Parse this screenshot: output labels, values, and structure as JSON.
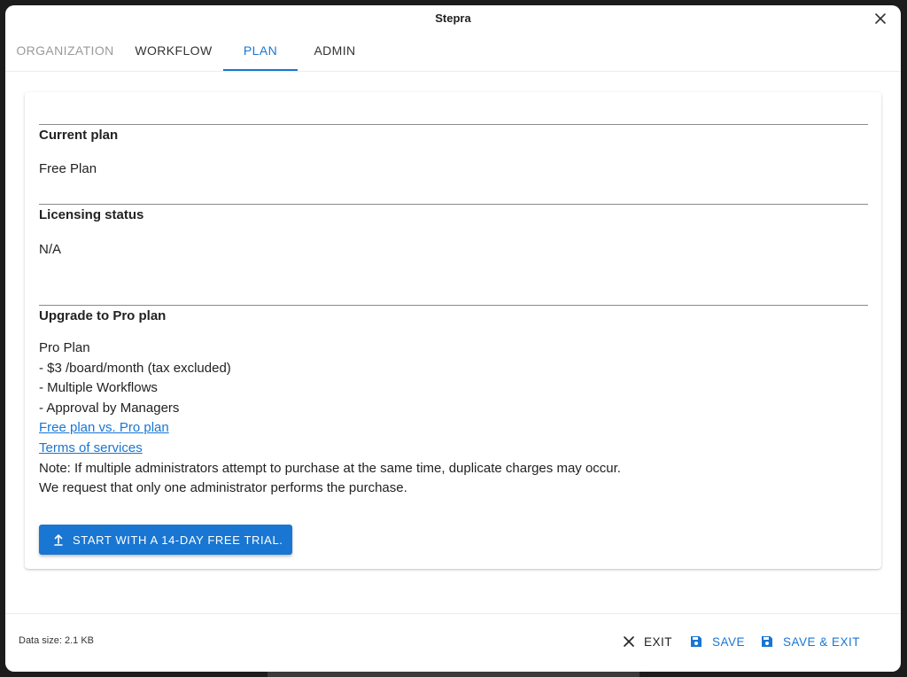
{
  "window": {
    "title": "Stepra",
    "close_icon": "close-icon"
  },
  "tabs": [
    {
      "label": "ORGANIZATION",
      "active": false
    },
    {
      "label": "WORKFLOW",
      "active": false
    },
    {
      "label": "PLAN",
      "active": true
    },
    {
      "label": "ADMIN",
      "active": false
    }
  ],
  "plan": {
    "current_plan": {
      "title": "Current plan",
      "value": "Free Plan"
    },
    "licensing_status": {
      "title": "Licensing status",
      "value": "N/A"
    },
    "upgrade": {
      "title": "Upgrade to Pro plan",
      "lines": [
        "Pro Plan",
        "- $3 /board/month (tax excluded)",
        "- Multiple Workflows",
        "- Approval by Managers"
      ],
      "links": [
        "Free plan vs. Pro plan",
        "Terms of services"
      ],
      "notes": [
        "Note: If multiple administrators attempt to purchase at the same time, duplicate charges may occur.",
        "We request that only one administrator performs the purchase."
      ],
      "trial_button_label": "START WITH A 14-DAY FREE TRIAL.",
      "trial_button_icon": "upload-icon"
    }
  },
  "footer": {
    "data_size": "Data size: 2.1 KB",
    "exit_label": "EXIT",
    "save_label": "SAVE",
    "save_exit_label": "SAVE & EXIT"
  },
  "colors": {
    "accent": "#1976d2",
    "text": "#222222",
    "tab_inactive": "#9a9a9a"
  }
}
